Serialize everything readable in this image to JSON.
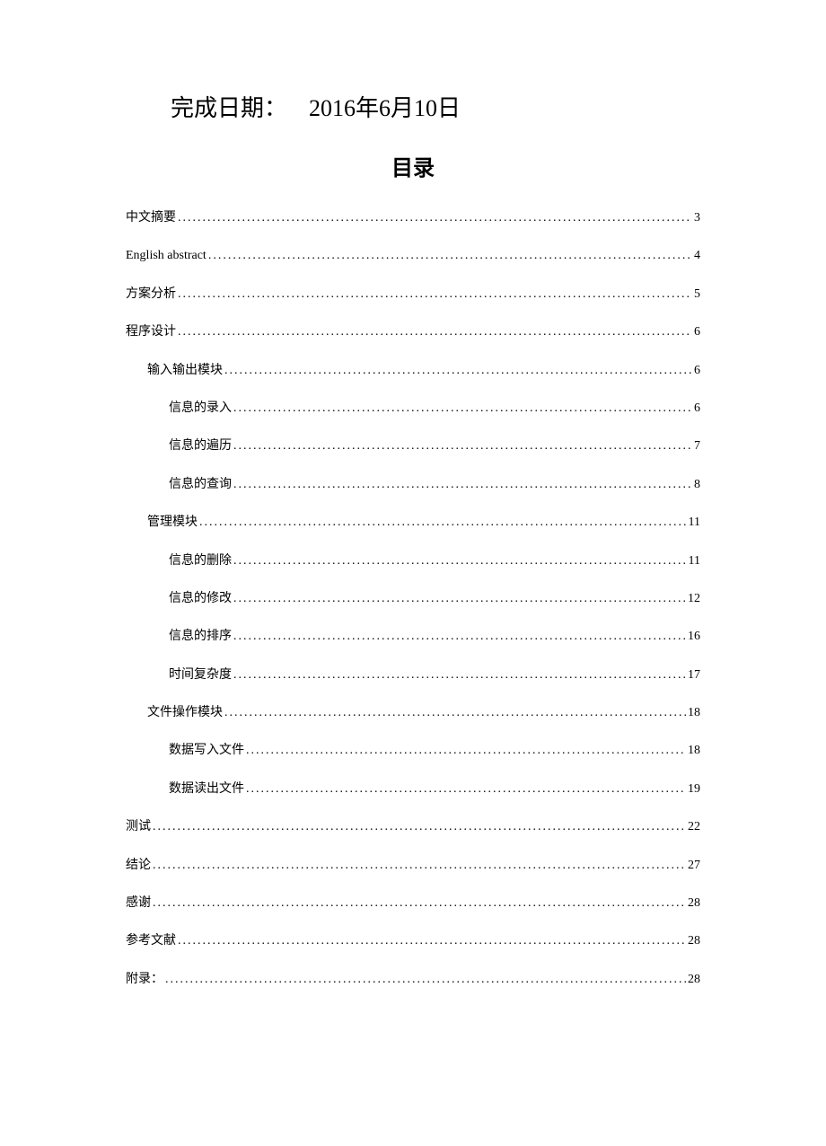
{
  "header": {
    "label": "完成日期：",
    "value": "2016年6月10日"
  },
  "toc_title": "目录",
  "toc": [
    {
      "label": "中文摘要",
      "page": "3",
      "level": 1
    },
    {
      "label": "English abstract",
      "page": "4",
      "level": 1
    },
    {
      "label": "方案分析",
      "page": "5",
      "level": 1
    },
    {
      "label": "程序设计",
      "page": "6",
      "level": 1
    },
    {
      "label": "输入输出模块",
      "page": "6",
      "level": 2
    },
    {
      "label": "信息的录入",
      "page": "6",
      "level": 3
    },
    {
      "label": "信息的遍历",
      "page": "7",
      "level": 3
    },
    {
      "label": "信息的查询",
      "page": "8",
      "level": 3
    },
    {
      "label": "管理模块",
      "page": "11",
      "level": 2
    },
    {
      "label": "信息的删除",
      "page": "11",
      "level": 3
    },
    {
      "label": "信息的修改",
      "page": "12",
      "level": 3
    },
    {
      "label": "信息的排序",
      "page": "16",
      "level": 3
    },
    {
      "label": "时间复杂度",
      "page": "17",
      "level": 3
    },
    {
      "label": "文件操作模块",
      "page": "18",
      "level": 2
    },
    {
      "label": "数据写入文件",
      "page": "18",
      "level": 3
    },
    {
      "label": "数据读出文件",
      "page": "19",
      "level": 3
    },
    {
      "label": "测试",
      "page": "22",
      "level": 1
    },
    {
      "label": "结论",
      "page": "27",
      "level": 1
    },
    {
      "label": "感谢",
      "page": "28",
      "level": 1
    },
    {
      "label": "参考文献",
      "page": "28",
      "level": 1
    },
    {
      "label": "附录：",
      "page": "28",
      "level": 1
    }
  ]
}
